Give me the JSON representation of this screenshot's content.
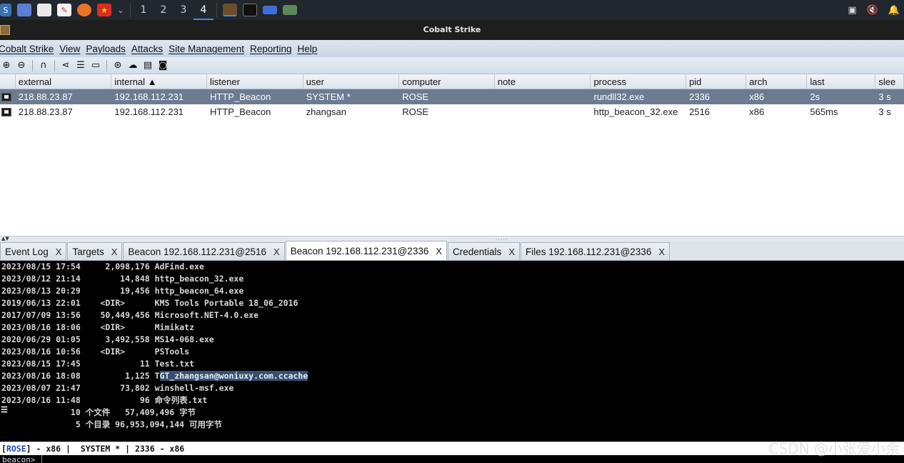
{
  "taskbar": {
    "workspaces": [
      "1",
      "2",
      "3",
      "4"
    ],
    "active_workspace": "4"
  },
  "window": {
    "title": "Cobalt Strike"
  },
  "menu": [
    "Cobalt Strike",
    "View",
    "Payloads",
    "Attacks",
    "Site Management",
    "Reporting",
    "Help"
  ],
  "toolbar": {
    "icons": [
      "add-connection-icon",
      "remove-connection-icon",
      "headphones-icon",
      "share-icon",
      "list-icon",
      "monitor-icon",
      "globe-icon",
      "cloud-icon",
      "keyboard-icon",
      "camera-icon"
    ]
  },
  "table": {
    "headers": [
      "external",
      "internal ▲",
      "listener",
      "user",
      "computer",
      "note",
      "process",
      "pid",
      "arch",
      "last",
      "slee"
    ],
    "rows": [
      [
        "218.88.23.87",
        "192.168.112.231",
        "HTTP_Beacon",
        "SYSTEM *",
        "ROSE",
        "",
        "rundll32.exe",
        "2336",
        "x86",
        "2s",
        "3 s"
      ],
      [
        "218.88.23.87",
        "192.168.112.231",
        "HTTP_Beacon",
        "zhangsan",
        "ROSE",
        "",
        "http_beacon_32.exe",
        "2516",
        "x86",
        "565ms",
        "3 s"
      ]
    ],
    "selected_row": 0
  },
  "tabs": [
    {
      "label": "Event Log",
      "close": "X"
    },
    {
      "label": "Targets",
      "close": "X"
    },
    {
      "label": "Beacon 192.168.112.231@2516",
      "close": "X"
    },
    {
      "label": "Beacon 192.168.112.231@2336",
      "close": "X"
    },
    {
      "label": "Credentials",
      "close": "X"
    },
    {
      "label": "Files 192.168.112.231@2336",
      "close": "X"
    }
  ],
  "active_tab": 3,
  "console": {
    "lines": [
      "2023/08/15 17:54     2,098,176 AdFind.exe",
      "2023/08/12 21:14        14,848 http_beacon_32.exe",
      "2023/08/13 20:29        19,456 http_beacon_64.exe",
      "2019/06/13 22:01    <DIR>      KMS Tools Portable 18_06_2016",
      "2017/07/09 13:56    50,449,456 Microsoft.NET-4.0.exe",
      "2023/08/16 18:06    <DIR>      Mimikatz",
      "2020/06/29 01:05     3,492,558 MS14-068.exe",
      "2023/08/16 10:56    <DIR>      PSTools",
      "2023/08/15 17:45            11 Test.txt",
      "2023/08/16 18:08         1,125 T",
      "2023/08/07 21:47        73,802 winshell-msf.exe",
      "2023/08/16 11:48            96 命令列表.txt",
      "              10 个文件   57,409,496 字节",
      "               5 个目录 96,953,094,144 可用字节"
    ],
    "highlighted_suffix": "GT_zhangsan@woniuxy.com.ccache"
  },
  "status": {
    "host": "ROSE",
    "rest": "] - x86 |  SYSTEM * | 2336 - x86"
  },
  "command": {
    "prompt": "beacon>",
    "value": ""
  },
  "watermark": "CSDN @小张爱小余"
}
